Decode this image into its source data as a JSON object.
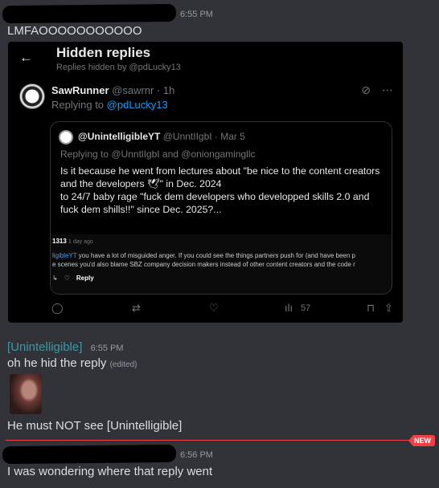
{
  "messages": [
    {
      "time": "6:55 PM",
      "text": "LMFAOOOOOOOOOOO"
    },
    {
      "username": "[Unintelligible]",
      "time": "6:55 PM",
      "text": "oh he hid the reply",
      "edited": "(edited)",
      "text2": "He must NOT see [Unintelligible]"
    },
    {
      "time": "6:56 PM",
      "text": "I was wondering where that reply went"
    }
  ],
  "new_badge": "NEW",
  "screenshot": {
    "back_icon": "back-arrow-icon",
    "title": "Hidden replies",
    "subtitle": "Replies hidden by @pdLucky13",
    "tweet": {
      "name": "SawRunner",
      "handle": "@sawrnr · 1h",
      "replying_prefix": "Replying to",
      "replying_to": "@pdLucky13",
      "quote": {
        "name": "@UnintelligibleYT",
        "handle": "@UnntIIgbI · Mar 5",
        "replying": "Replying to @UnntlIgbI and @oniongamingllc",
        "body": "Is it because he went from lectures about \"be nice to the content creators and the developers 🕊\" in Dec. 2024\nto 24/7 baby rage \"fuck dem developers who developped skills 2.0 and fuck dem shills!!\" since Dec. 2025?...",
        "inner": {
          "user": "1313",
          "time": "1 day ago",
          "line1_prefix": "ligibleYT",
          "line1": " you have a lot of misguided anger. If you could see the things partners push for (and have been p",
          "line2": "e scenes you'd also blame SBZ company decision makers instead of other content creators and the code r",
          "reply": "Reply"
        }
      },
      "views": "57"
    }
  }
}
